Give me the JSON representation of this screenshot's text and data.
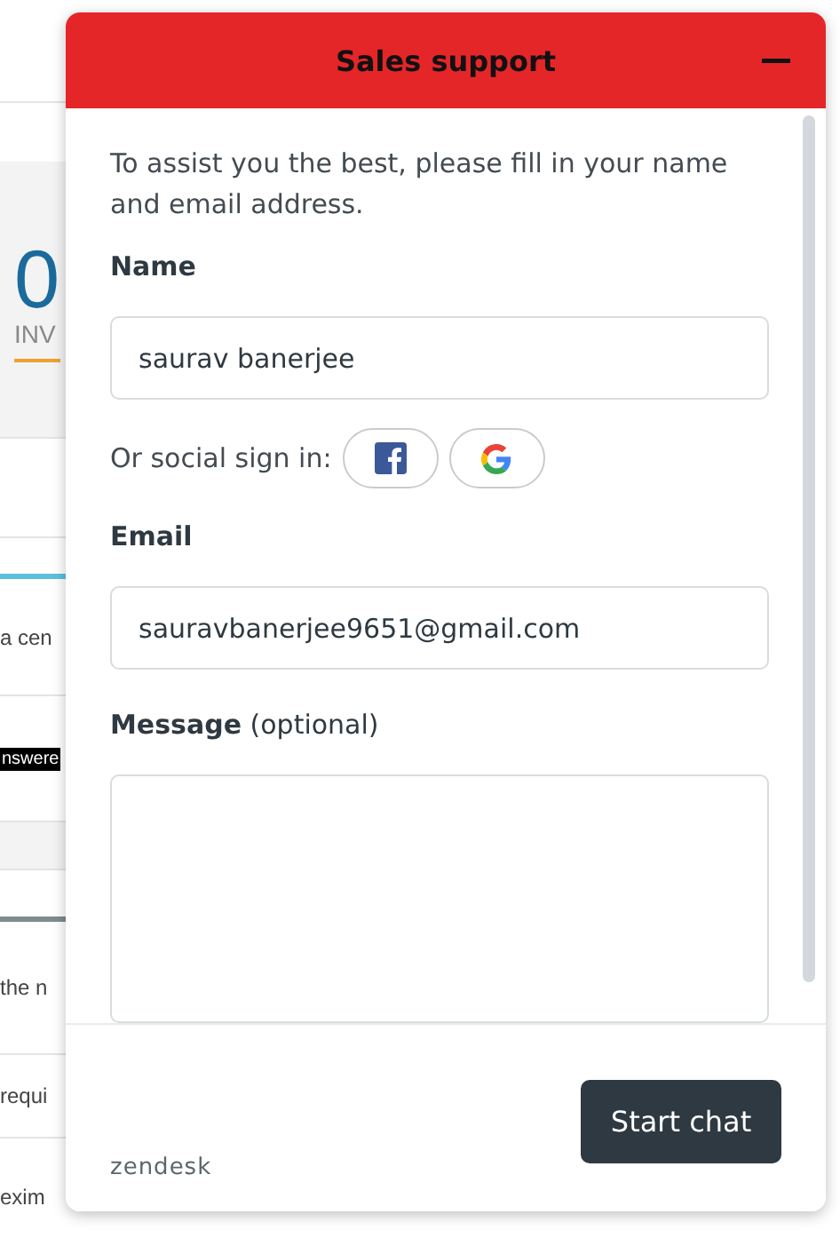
{
  "background": {
    "stat_value": "0",
    "stat_label": "INV",
    "text_1": "a cen",
    "badge": "nswere",
    "text_2": "the n",
    "text_3": "requi",
    "text_4": "exim"
  },
  "widget": {
    "title": "Sales support",
    "intro": "To assist you the best, please fill in your name and email address.",
    "name_label": "Name",
    "name_value": "saurav banerjee",
    "social_label": "Or social sign in:",
    "email_label": "Email",
    "email_value": "sauravbanerjee9651@gmail.com",
    "message_label": "**Message** (optional)",
    "brand": "zendesk",
    "submit": "Start chat"
  }
}
